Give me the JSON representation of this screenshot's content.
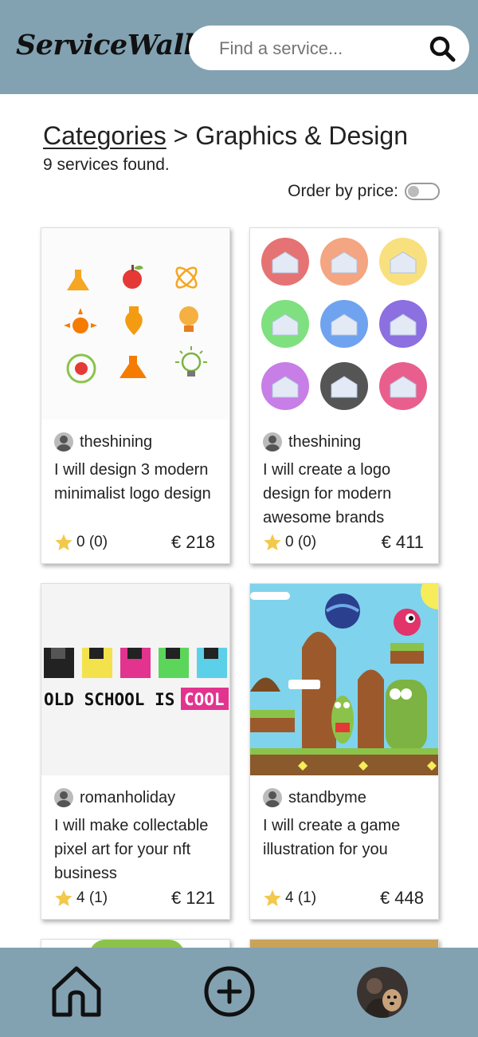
{
  "header": {
    "logo": "ServiceWall",
    "search_placeholder": "Find a service..."
  },
  "breadcrumb": {
    "root": "Categories",
    "separator": ">",
    "current": "Graphics & Design"
  },
  "results_count": "9 services found.",
  "order_label": "Order by price:",
  "order_by_price": false,
  "colors": {
    "bar": "#82a2b2",
    "star": "#f2c94c"
  },
  "services": [
    {
      "seller": "theshining",
      "title": "I will design 3 modern minimalist logo design",
      "rating": "0 (0)",
      "price": "€ 218"
    },
    {
      "seller": "theshining",
      "title": "I will create a logo design for modern awesome brands",
      "rating": "0 (0)",
      "price": "€ 411"
    },
    {
      "seller": "romanholiday",
      "title": "I will make collectable pixel art for your nft business",
      "rating": "4 (1)",
      "price": "€ 121"
    },
    {
      "seller": "standbyme",
      "title": "I will create a game illustration for you",
      "rating": "4 (1)",
      "price": "€ 448"
    }
  ],
  "pixel_art_text": [
    "OLD SCHOOL IS",
    "COOL"
  ],
  "nav": {
    "home_icon": "home-icon",
    "add_icon": "add-circle-icon",
    "profile": "profile-avatar"
  }
}
